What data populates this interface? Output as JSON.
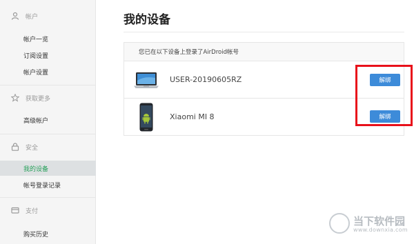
{
  "sidebar": {
    "sections": [
      {
        "icon": "user-icon",
        "label": "帐户",
        "items": [
          "帐户一览",
          "订阅设置",
          "帐户设置"
        ]
      },
      {
        "icon": "star-icon",
        "label": "获取更多",
        "items": [
          "高级帐户"
        ]
      },
      {
        "icon": "lock-icon",
        "label": "安全",
        "items": [
          "我的设备",
          "帐号登录记录"
        ]
      },
      {
        "icon": "card-icon",
        "label": "支付",
        "items": [
          "购买历史"
        ]
      }
    ],
    "active_item": "我的设备"
  },
  "main": {
    "title": "我的设备",
    "card_header": "您已在以下设备上登录了AirDroid帐号",
    "devices": [
      {
        "icon": "laptop-icon",
        "name": "USER-20190605RZ",
        "button": "解绑"
      },
      {
        "icon": "phone-icon",
        "name": "Xiaomi MI 8",
        "button": "解绑"
      }
    ]
  },
  "watermark": {
    "cn": "当下软件园",
    "en": "www.downxia.com"
  },
  "colors": {
    "accent": "#27a05a",
    "button": "#3d8bd9",
    "highlight": "#e8101a"
  }
}
